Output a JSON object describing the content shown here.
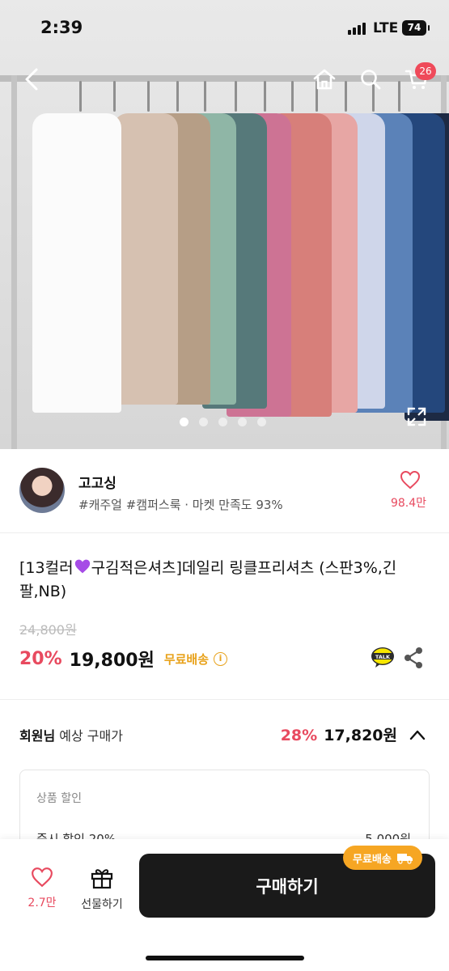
{
  "status": {
    "time": "2:39",
    "network": "LTE",
    "battery": "74"
  },
  "nav": {
    "back": "chevron-left-icon",
    "home": "home-icon",
    "search": "search-icon",
    "cart": "cart-icon",
    "cart_count": "26"
  },
  "gallery": {
    "total_slides": 5,
    "active_slide": 1
  },
  "shop": {
    "name": "고고싱",
    "tags": "#캐주얼 #캠퍼스룩 · 마켓 만족도 93%",
    "likes": "98.4만"
  },
  "product": {
    "title_prefix": "[13컬러",
    "title_rest": "구김적은셔츠]데일리 링클프리셔츠 (스판3%,긴팔,NB)",
    "original_price": "24,800원",
    "discount": "20%",
    "price": "19,800원",
    "shipping": "무료배송"
  },
  "member": {
    "label_bold": "회원님",
    "label_rest": " 예상 구매가",
    "discount": "28%",
    "price": "17,820원"
  },
  "discount_box": {
    "title": "상품 할인",
    "line_label": "즉시 할인 20%",
    "line_value": "-5,000원"
  },
  "bottom_bar": {
    "likes": "2.7만",
    "gift_label": "선물하기",
    "buy_label": "구매하기",
    "ship_chip": "무료배송"
  },
  "colors": {
    "accent": "#e84a5f",
    "shipping": "#e8a21b",
    "buy_button": "#1a1a1a"
  }
}
